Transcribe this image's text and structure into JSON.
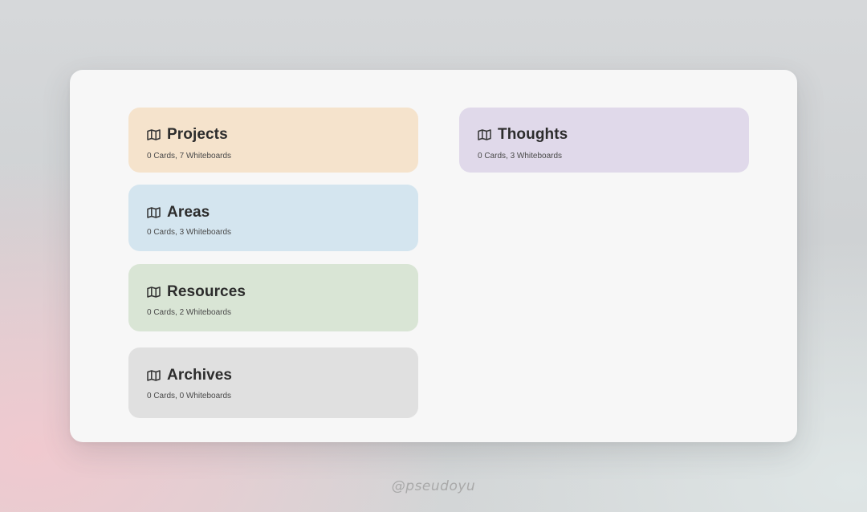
{
  "colors": {
    "projects": "#f5e3cc",
    "areas": "#d4e5ef",
    "resources": "#d9e5d5",
    "archives": "#e0e0e0",
    "thoughts": "#e0d9ea",
    "panel": "#f7f7f7",
    "title_text": "#2c2c2c"
  },
  "cards": [
    {
      "title": "Projects",
      "subtitle": "0 Cards, 7 Whiteboards",
      "icon": "map-icon"
    },
    {
      "title": "Areas",
      "subtitle": "0 Cards, 3 Whiteboards",
      "icon": "map-icon"
    },
    {
      "title": "Resources",
      "subtitle": "0 Cards, 2 Whiteboards",
      "icon": "map-icon"
    },
    {
      "title": "Archives",
      "subtitle": "0 Cards, 0 Whiteboards",
      "icon": "map-icon"
    },
    {
      "title": "Thoughts",
      "subtitle": "0 Cards, 3 Whiteboards",
      "icon": "map-icon"
    }
  ],
  "watermark": "@pseudoyu"
}
